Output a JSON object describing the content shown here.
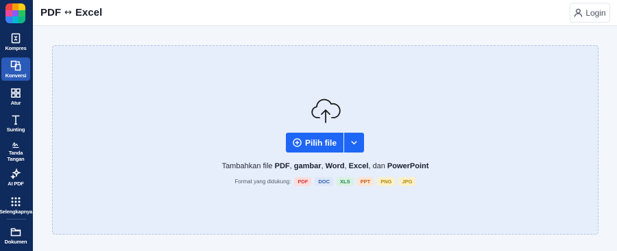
{
  "sidebar": {
    "items": [
      {
        "label": "Kompres",
        "icon": "compress-icon"
      },
      {
        "label": "Konversi",
        "icon": "convert-icon"
      },
      {
        "label": "Atur",
        "icon": "grid-icon"
      },
      {
        "label": "Sunting",
        "icon": "text-icon"
      },
      {
        "label": "Tanda\nTangan",
        "icon": "signature-icon"
      },
      {
        "label": "AI PDF",
        "icon": "sparkle-icon"
      },
      {
        "label": "Selengkapnya",
        "icon": "apps-icon"
      },
      {
        "label": "Dokumen",
        "icon": "folder-icon"
      }
    ]
  },
  "header": {
    "title_left": "PDF",
    "title_arrow": "↔",
    "title_right": "Excel",
    "login_label": "Login"
  },
  "upload": {
    "button_label": "Pilih file",
    "desc_prefix": "Tambahkan file ",
    "desc_pdf": "PDF",
    "desc_sep1": ", ",
    "desc_gambar": "gambar",
    "desc_sep2": ", ",
    "desc_word": "Word",
    "desc_sep3": ", ",
    "desc_excel": "Excel",
    "desc_sep4": ", dan ",
    "desc_ppt": "PowerPoint",
    "formats_label": "Format yang didukung:",
    "formats": [
      {
        "label": "PDF",
        "color": "#d93b3b",
        "bg": "#fbdede"
      },
      {
        "label": "DOC",
        "color": "#2f5fb3",
        "bg": "#dde7f7"
      },
      {
        "label": "XLS",
        "color": "#1e8a4c",
        "bg": "#d9f1e2"
      },
      {
        "label": "PPT",
        "color": "#c8621f",
        "bg": "#fbe5d3"
      },
      {
        "label": "PNG",
        "color": "#b58a10",
        "bg": "#fbf0c9"
      },
      {
        "label": "JPG",
        "color": "#b58a10",
        "bg": "#fbf0c9"
      }
    ]
  },
  "colors": {
    "sidebar_bg": "#0f2a5c",
    "active_bg": "#2b5bb8",
    "primary": "#1e66f5",
    "dropzone_bg": "#e6eefb"
  }
}
